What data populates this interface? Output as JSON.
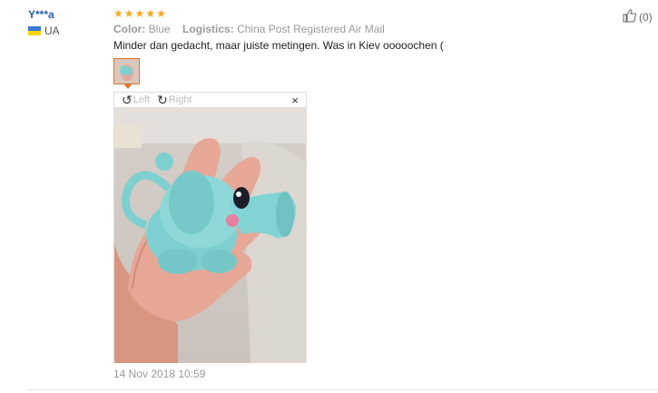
{
  "review": {
    "user_name": "Y***a",
    "country": "UA",
    "rating": 5,
    "color_label": "Color:",
    "color_value": "Blue",
    "logistics_label": "Logistics:",
    "logistics_value": "China Post Registered Air Mail",
    "text": "Minder dan gedacht, maar juiste metingen. Was in Kiev ooooochen (",
    "date": "14 Nov 2018 10:59",
    "helpful_count": "(0)"
  },
  "viewer": {
    "rotate_left_label": "Left",
    "rotate_right_label": "Right",
    "close_symbol": "×"
  },
  "icons": {
    "star": "star-icon",
    "rotate_left": "rotate-left-icon",
    "rotate_right": "rotate-right-icon",
    "thumbs_up": "thumbs-up-icon",
    "close": "close-icon"
  },
  "colors": {
    "username": "#2b5ea8",
    "star": "#f6a623",
    "thumb_border": "#e07020",
    "toy": "#7ecfd0"
  }
}
